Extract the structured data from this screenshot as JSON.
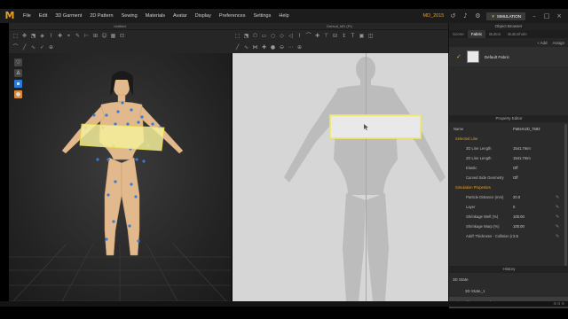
{
  "app": {
    "logo": "M",
    "menu": [
      "File",
      "Edit",
      "3D Garment",
      "2D Pattern",
      "Sewing",
      "Materials",
      "Avatar",
      "Display",
      "Preferences",
      "Settings",
      "Help"
    ],
    "filename": "MD_2015",
    "mode_button": "SIMULATION"
  },
  "toolbar3d": {
    "title": "Untitled"
  },
  "toolbar2d": {
    "title": "Default_MD (Pt)"
  },
  "view3d": {
    "tool_icons": [
      "hanger-icon",
      "avatar-icon",
      "garment-icon",
      "person-icon"
    ]
  },
  "object_browser": {
    "title": "Object Browser",
    "tabs": [
      "Scene",
      "Fabric",
      "Button",
      "Buttonhole"
    ],
    "active_tab": "Fabric",
    "add_label": "+ Add",
    "assign_label": "Assign",
    "fabric_name": "Default Fabric"
  },
  "property_editor": {
    "title": "Property Editor",
    "name_label": "Name",
    "name_value": "Pattern2D_7583",
    "selected_line": "Selected Line",
    "line_3d_length_label": "3D Line Length",
    "line_3d_length": "1541.7mm",
    "line_2d_length_label": "2D Line Length",
    "line_2d_length": "1541.7mm",
    "elastic_label": "Elastic",
    "elastic_value": "Off",
    "curved_label": "Curved Side Geometry",
    "curved_value": "Off",
    "sim_props": "Simulation Properties",
    "particle_label": "Particle Distance (mm)",
    "particle_value": "20.0",
    "layer_label": "Layer",
    "layer_value": "0",
    "shrink_weft_label": "Shrinkage Weft (%)",
    "shrink_weft_value": "100.00",
    "shrink_warp_label": "Shrinkage Warp (%)",
    "shrink_warp_value": "100.00",
    "add_thick_label": "Add'l Thickness - Collision (r",
    "add_thick_value": "2.5"
  },
  "history": {
    "title": "History",
    "root": "3D State",
    "items": [
      "3D State_1",
      "Rectangle"
    ]
  },
  "colors": {
    "accent": "#e8a020",
    "selection": "#f0e860",
    "avatar_points": "#3a7bd5"
  }
}
